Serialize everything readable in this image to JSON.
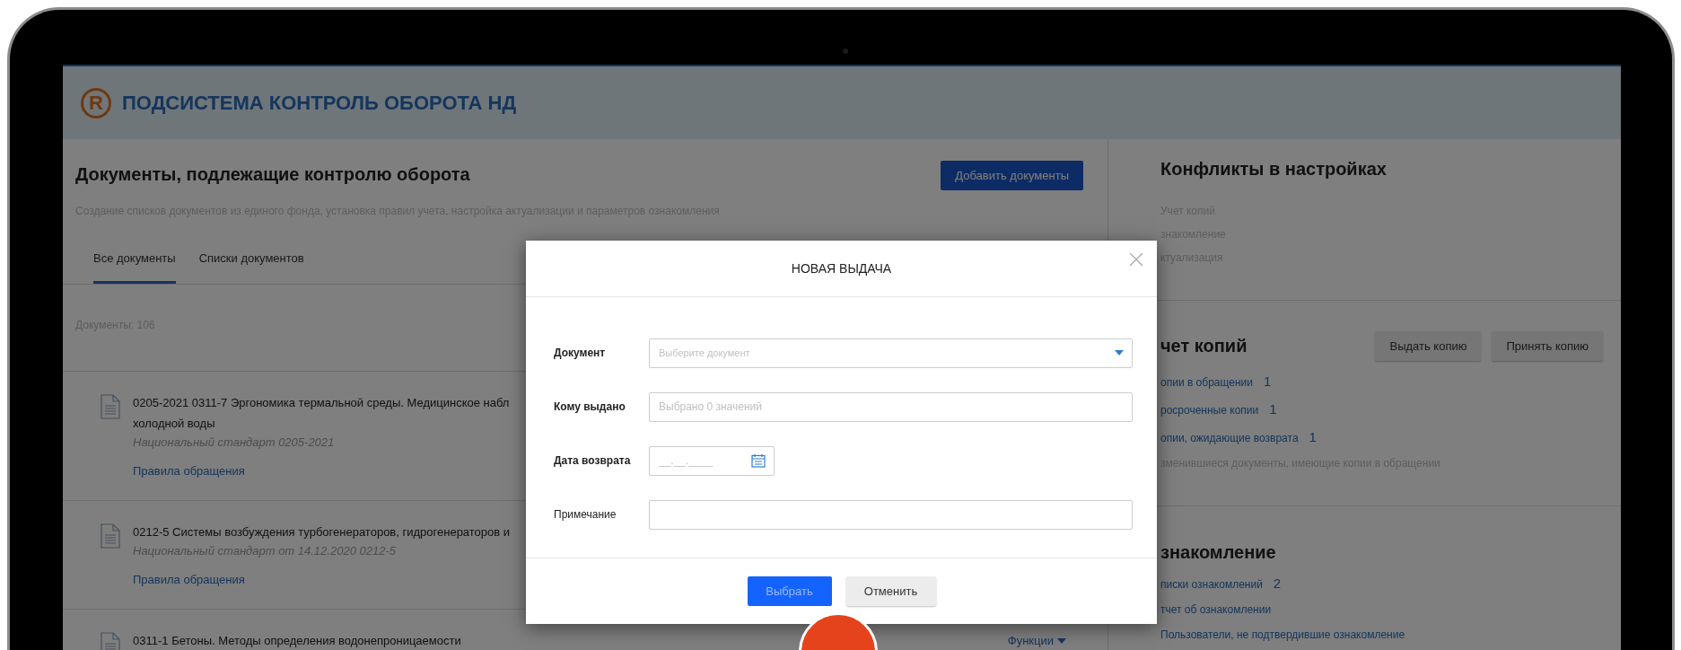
{
  "header": {
    "logo": "R",
    "title": "ПОДСИСТЕМА КОНТРОЛЬ ОБОРОТА НД"
  },
  "main": {
    "title": "Документы, подлежащие контролю оборота",
    "subtitle": "Создание списков документов из единого фонда, установка правил учета, настройка актуализации и параметров ознакомления",
    "add_button": "Добавить документы",
    "tabs": [
      {
        "label": "Все документы",
        "selected": true
      },
      {
        "label": "Списки документов",
        "selected": false
      }
    ],
    "count": "Документы: 106",
    "documents": [
      {
        "title_lines": [
          "0205-2021 0311-7 Эргономика термальной среды. Медицинское набл",
          "холодной воды"
        ],
        "subtitle": "Национальный стандарт 0205-2021",
        "link": "Правила обращения"
      },
      {
        "title_lines": [
          "0212-5 Системы возбуждения турбогенераторов, гидрогенераторов и"
        ],
        "subtitle": "Национальный стандарт от 14.12.2020 0212-5",
        "link": "Правила обращения"
      },
      {
        "title_lines": [
          "0311-1 Бетоны. Методы определения водонепроницаемости"
        ],
        "menu": "Функции"
      }
    ]
  },
  "conflicts": {
    "title": "Конфликты в настройках",
    "items": [
      "Учет копий",
      "знакомление",
      "ктуализация"
    ]
  },
  "copies": {
    "title": "чет копий",
    "buttons": [
      "Выдать копию",
      "Принять копию"
    ],
    "links": [
      {
        "label": "опии в обращении",
        "count": "1"
      },
      {
        "label": "росроченные копии",
        "count": "1"
      },
      {
        "label": "опии, ожидающие возврата",
        "count": "1"
      }
    ],
    "note": "зменившиеся документы, имеющие копии в обращении"
  },
  "familiarization": {
    "title": "знакомление",
    "links": [
      {
        "label": "писки ознакомлений",
        "count": "2"
      },
      {
        "label": "тчет об ознакомлении"
      },
      {
        "label": "Пользователи, не подтвердившие ознакомление"
      }
    ]
  },
  "modal": {
    "title": "НОВАЯ ВЫДАЧА",
    "fields": [
      {
        "label": "Документ",
        "required": true,
        "kind": "select",
        "placeholder": "Выберите документ"
      },
      {
        "label": "Кому выдано",
        "required": true,
        "kind": "text",
        "placeholder": "Выбрано 0 значений"
      },
      {
        "label": "Дата возврата",
        "required": true,
        "kind": "date",
        "placeholder": "__.__.____"
      },
      {
        "label": "Примечание",
        "required": false,
        "kind": "text"
      }
    ],
    "buttons": [
      {
        "label": "Выбрать",
        "kind": "primary",
        "disabled": true
      },
      {
        "label": "Отменить",
        "kind": "secondary",
        "disabled": false
      }
    ]
  }
}
